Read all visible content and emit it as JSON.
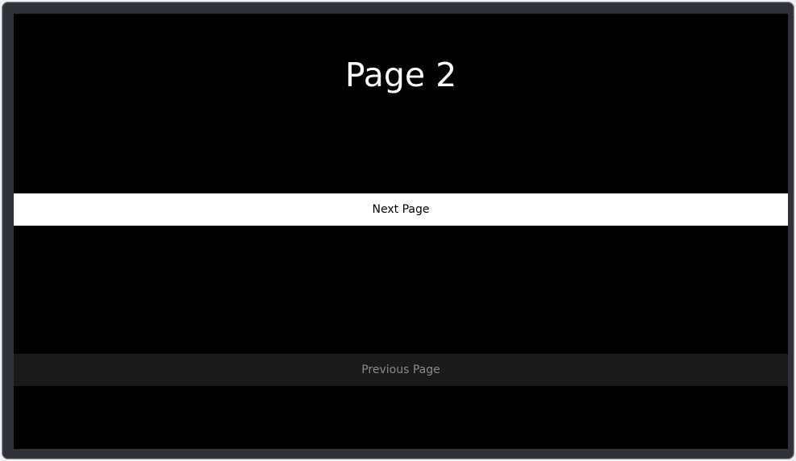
{
  "page": {
    "title": "Page 2"
  },
  "buttons": {
    "next_label": "Next Page",
    "previous_label": "Previous Page"
  },
  "colors": {
    "screen_background": "#000000",
    "focused_button_background": "#ffffff",
    "unfocused_button_background": "#1a1a1a",
    "frame": "#2e3138"
  }
}
